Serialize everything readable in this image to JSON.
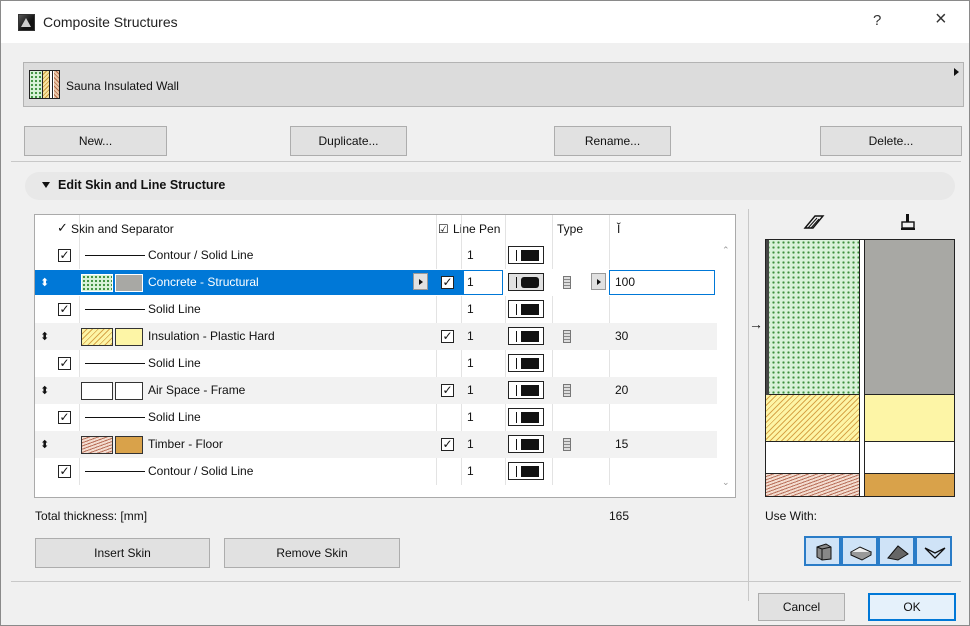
{
  "window": {
    "title": "Composite Structures",
    "help": "?",
    "close": "×"
  },
  "selector": {
    "name": "Sauna Insulated Wall"
  },
  "buttons": {
    "new": "New...",
    "duplicate": "Duplicate...",
    "rename": "Rename...",
    "delete": "Delete..."
  },
  "section": {
    "label": "Edit Skin and Line Structure"
  },
  "table": {
    "headers": {
      "skin": "Skin and Separator",
      "line_pen": "Line Pen",
      "type": "Type"
    },
    "rows": [
      {
        "kind": "line",
        "checked": true,
        "label": "Contour / Solid Line",
        "pen": "1",
        "thickness": ""
      },
      {
        "kind": "skin",
        "checked": true,
        "label": "Concrete - Structural",
        "pen": "1",
        "thickness": "100",
        "selected": true
      },
      {
        "kind": "line",
        "checked": true,
        "label": "Solid Line",
        "pen": "1",
        "thickness": ""
      },
      {
        "kind": "skin",
        "checked": true,
        "label": "Insulation - Plastic Hard",
        "pen": "1",
        "thickness": "30"
      },
      {
        "kind": "line",
        "checked": true,
        "label": "Solid Line",
        "pen": "1",
        "thickness": ""
      },
      {
        "kind": "skin",
        "checked": true,
        "label": "Air Space - Frame",
        "pen": "1",
        "thickness": "20"
      },
      {
        "kind": "line",
        "checked": true,
        "label": "Solid Line",
        "pen": "1",
        "thickness": ""
      },
      {
        "kind": "skin",
        "checked": true,
        "label": "Timber - Floor",
        "pen": "1",
        "thickness": "15"
      },
      {
        "kind": "line",
        "checked": true,
        "label": "Contour / Solid Line",
        "pen": "1",
        "thickness": ""
      }
    ]
  },
  "total": {
    "label": "Total thickness: [mm]",
    "value": "165"
  },
  "skin_buttons": {
    "insert": "Insert Skin",
    "remove": "Remove Skin"
  },
  "preview": {
    "use_with": "Use With:"
  },
  "footer": {
    "cancel": "Cancel",
    "ok": "OK"
  },
  "colors": {
    "selection": "#0078d7",
    "concrete": "#a8a8a4",
    "insulation": "#fdf5a6",
    "timber": "#d9a24a"
  }
}
